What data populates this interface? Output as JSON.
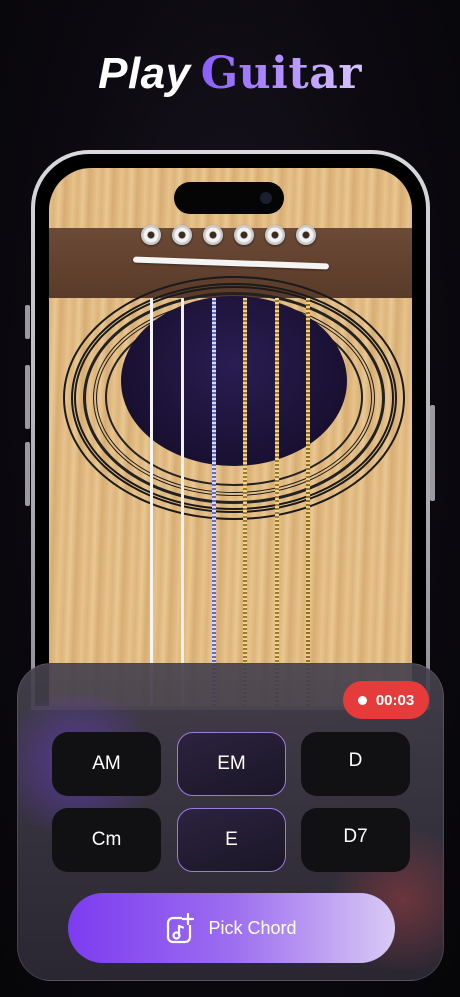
{
  "headline": {
    "word1": "Play",
    "word2": "Guitar"
  },
  "recording": {
    "time": "00:03",
    "color": "#e53b3b"
  },
  "chords": [
    {
      "label": "AM",
      "selected": false
    },
    {
      "label": "EM",
      "selected": true
    },
    {
      "label": "D",
      "selected": false
    },
    {
      "label": "Cm",
      "selected": false
    },
    {
      "label": "E",
      "selected": true
    },
    {
      "label": "D7",
      "selected": false
    }
  ],
  "pick_chord": {
    "label": "Pick Chord",
    "icon": "music-note-add-icon"
  },
  "colors": {
    "accent": "#8b5cff",
    "panel": "#3a3644",
    "background": "#0c0a10"
  }
}
